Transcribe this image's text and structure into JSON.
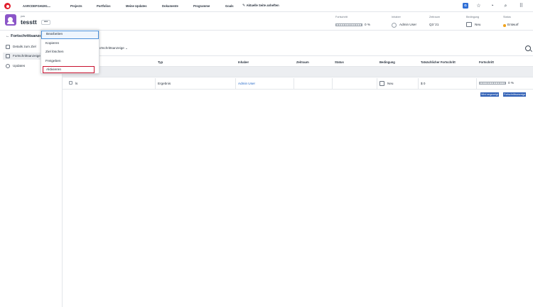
{
  "topnav": {
    "app_name": "AARCDEFGHIJKL...",
    "items": [
      "Projects",
      "Portfolios",
      "Meine Updates",
      "Dokumente",
      "Programme",
      "Goals"
    ],
    "pin_label": "Aktuelle Seite anheften",
    "badge": "G"
  },
  "header": {
    "breadcrumb": "pas",
    "title": "tesstt",
    "more": "•••",
    "progress_label": "Fortschritt",
    "progress_value": "0 %",
    "progress_fraction": 0,
    "owner_label": "Inhaber",
    "owner_value": "Admin User",
    "period_label": "Zeitraum",
    "period_value": "Q3 '21",
    "condition_label": "Bedingung",
    "condition_value": "Neu",
    "status_label": "Status",
    "status_value": "Entwurf",
    "status_color": "#f0a31e"
  },
  "sidebar": {
    "back_label": "Fortschrittsanzeige",
    "items": [
      {
        "label": "Details zum Ziel",
        "icon": "document-icon"
      },
      {
        "label": "Fortschrittsanzeige",
        "icon": "progress-icon"
      },
      {
        "label": "Updates",
        "icon": "chat-icon"
      }
    ]
  },
  "main": {
    "view_selector": "Fortschrittsanzeige",
    "columns": [
      "Typ",
      "Inhaber",
      "Zeitraum",
      "Status",
      "Bedingung",
      "Tatsächlicher Fortschritt",
      "Fortschritt"
    ],
    "row": {
      "name": "ls",
      "type": "Ergebnis",
      "owner": "Admin User",
      "period": "",
      "status": "",
      "condition": "Neu",
      "actual": "$ 0",
      "progress": "0 %",
      "progress_fraction": 0
    },
    "chips": [
      "Wird angezeigt",
      "Fortschrittsanzeige"
    ]
  },
  "menu": {
    "items": [
      "Bearbeiten",
      "Kopieren",
      "Ziel löschen",
      "Freigeben",
      "Aktivieren"
    ]
  }
}
